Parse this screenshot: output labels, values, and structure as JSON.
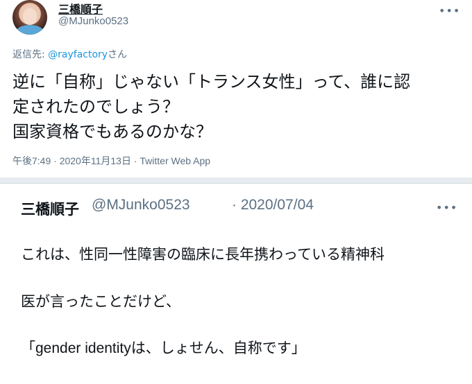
{
  "tweet": {
    "display_name": "三橋順子",
    "handle": "@MJunko0523",
    "reply_prefix": "返信先: ",
    "reply_mention": "@rayfactory",
    "reply_suffix": "さん",
    "body": "逆に「自称」じゃない「トランス女性」って、誰に認\n定されたのでしょう？\n国家資格でもあるのかな？",
    "meta": "午後7:49 · 2020年11月13日 · Twitter Web App",
    "more_label": "•••"
  },
  "quoted": {
    "display_name": "三橋順子",
    "handle": "@MJunko0523",
    "date": "· 2020/07/04",
    "more_label": "•••",
    "line1": "これは、性同一性障害の臨床に長年携わっている精神科",
    "line2": "医が言ったことだけど、",
    "line3": "「gender identityは、しょせん、自称です」"
  },
  "colors": {
    "link": "#1b95e0",
    "secondary_text": "#5b7083",
    "separator": "#e6ecf0"
  },
  "icons": {
    "more": "more-horizontal-icon"
  }
}
